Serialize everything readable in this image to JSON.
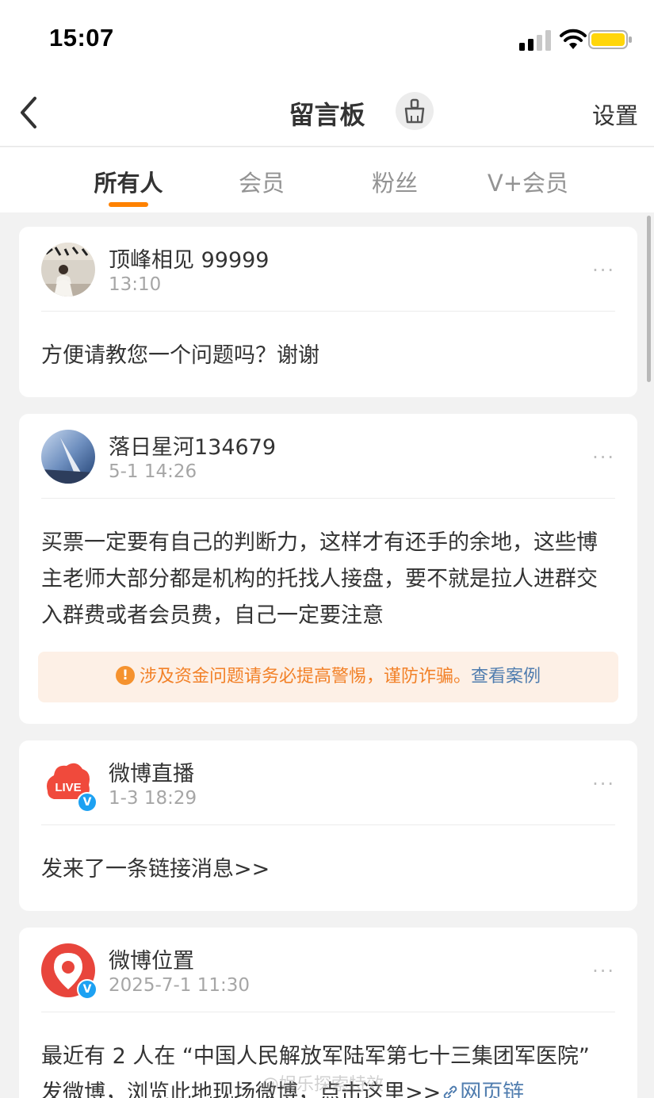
{
  "status_bar": {
    "time": "15:07"
  },
  "nav": {
    "title": "留言板",
    "settings_label": "设置"
  },
  "tabs": [
    {
      "label": "所有人",
      "active": true
    },
    {
      "label": "会员",
      "active": false
    },
    {
      "label": "粉丝",
      "active": false
    },
    {
      "label": "V+会员",
      "active": false
    }
  ],
  "messages": [
    {
      "name": "顶峰相见 99999",
      "time": "13:10",
      "content": "方便请教您一个问题吗？谢谢"
    },
    {
      "name": "落日星河134679",
      "time": "5-1 14:26",
      "content": "买票一定要有自己的判断力，这样才有还手的余地，这些博主老师大部分都是机构的托找人接盘，要不就是拉人进群交入群费或者会员费，自己一定要注意",
      "warning": {
        "text": "涉及资金问题请务必提高警惕，谨防诈骗。",
        "link": "查看案例",
        "icon": "!"
      }
    },
    {
      "name": "微博直播",
      "time": "1-3 18:29",
      "content": "发来了一条链接消息>>",
      "verified": "V"
    },
    {
      "name": "微博位置",
      "time": "2025-7-1 11:30",
      "content": "最近有 2 人在 “中国人民解放军陆军第七十三集团军医院” 发微博，浏览此地现场微博，点击这里>>",
      "link": "网页链",
      "verified": "V"
    }
  ],
  "more_label": "···",
  "watermark": "@娱乐探索特效",
  "colors": {
    "accent": "#ff8200",
    "link": "#507daf",
    "warning": "#f28128"
  },
  "icons": {
    "back": "chevron-left-icon",
    "clean": "broom-icon",
    "more": "more-icon",
    "verified": "verified-badge-icon",
    "warning": "info-icon",
    "link": "link-icon"
  }
}
